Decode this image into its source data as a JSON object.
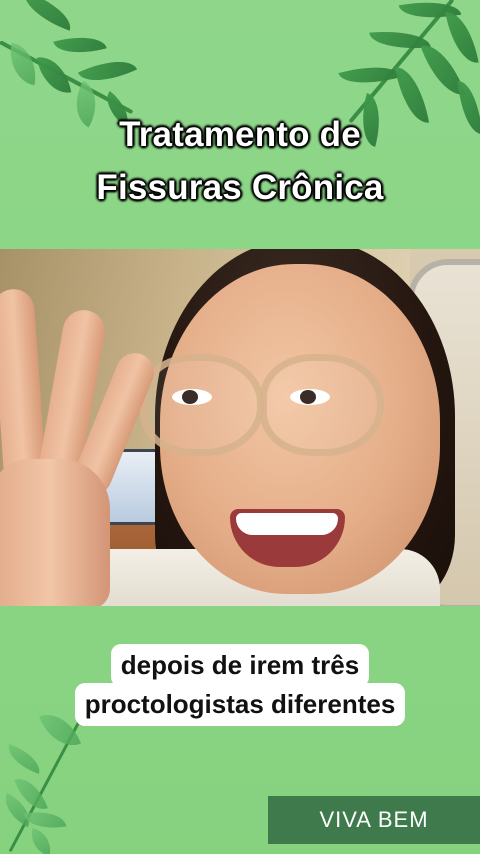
{
  "title": {
    "line1": "Tratamento de",
    "line2": "Fissuras Crônica"
  },
  "subtitle": {
    "line1": "depois de irem três",
    "line2": "proctologistas diferentes"
  },
  "brand": {
    "label": "VIVA BEM"
  },
  "colors": {
    "background": "#8fd68a",
    "leaf": "#3f9a4a",
    "brand_badge": "#3e7a4b",
    "caption_bg": "#ffffff"
  },
  "icons": [
    "leaf-branch-icon"
  ]
}
